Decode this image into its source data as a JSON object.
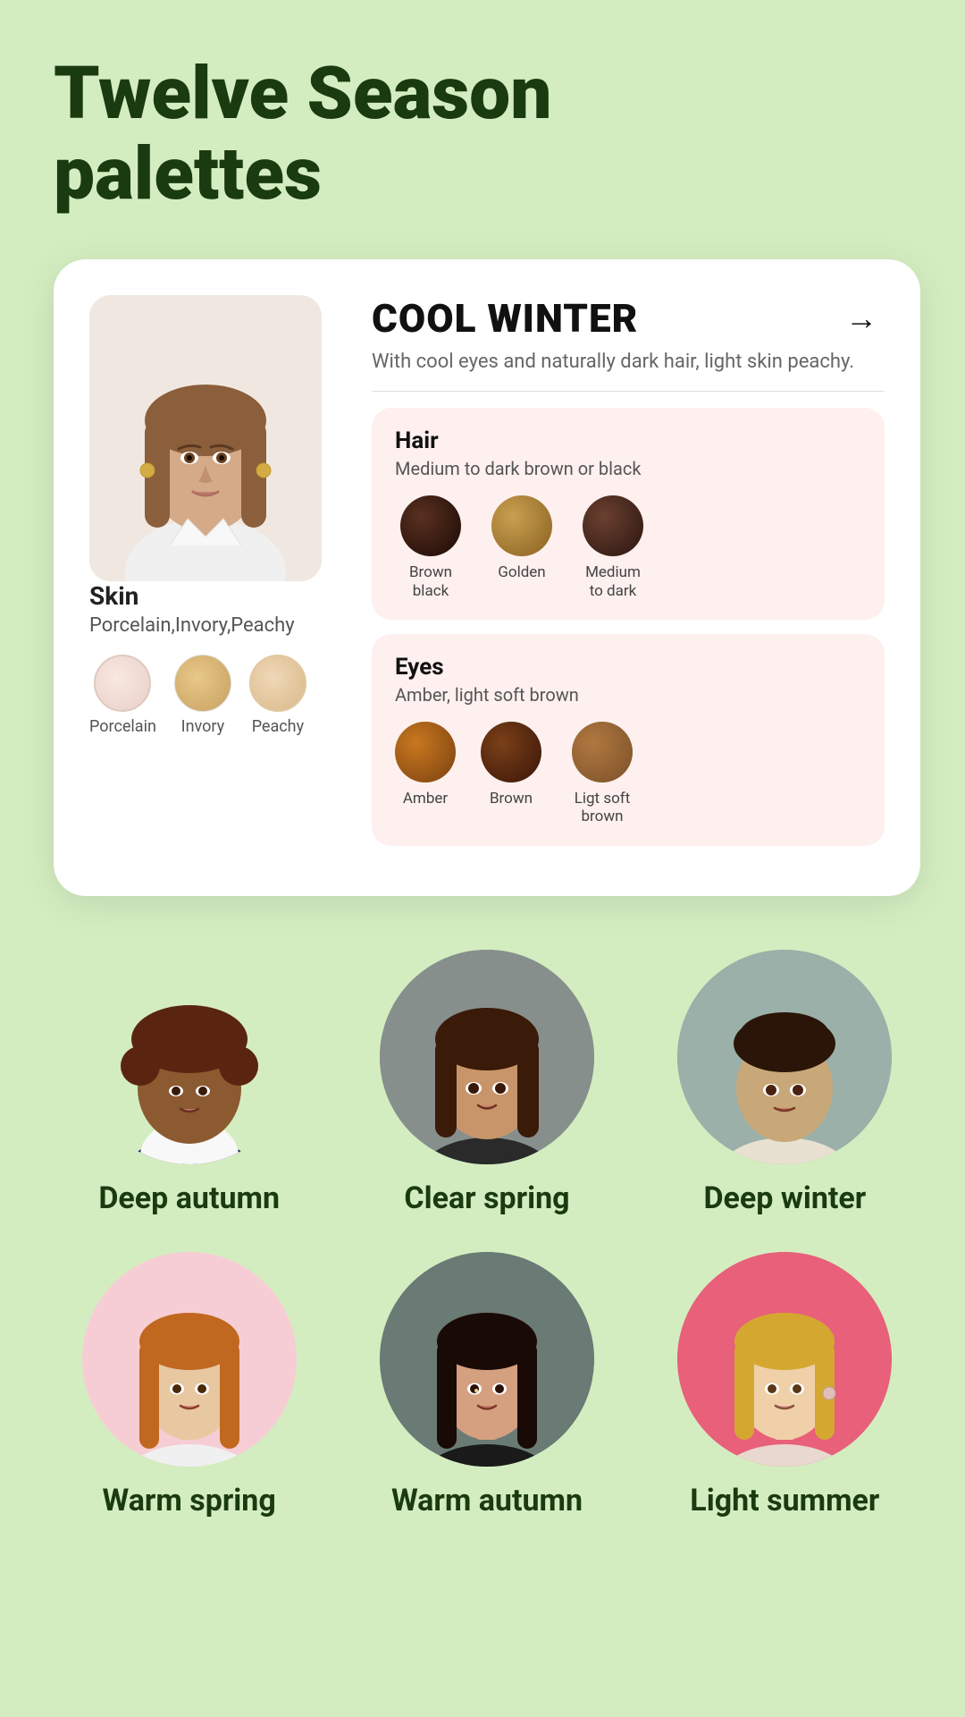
{
  "page": {
    "title_line1": "Twelve Season",
    "title_line2": "palettes"
  },
  "card": {
    "season_name": "COOL WINTER",
    "season_desc": "With cool eyes and naturally dark hair, light skin peachy.",
    "arrow": "→",
    "skin": {
      "label": "Skin",
      "sublabel": "Porcelain,Invory,Peachy",
      "swatches": [
        {
          "label": "Porcelain",
          "class": "skin-porcelain"
        },
        {
          "label": "Invory",
          "class": "skin-ivory"
        },
        {
          "label": "Peachy",
          "class": "skin-peachy"
        }
      ]
    },
    "hair": {
      "title": "Hair",
      "subtitle": "Medium to dark brown or black",
      "swatches": [
        {
          "label": "Brown black",
          "class": "hair-brown-black"
        },
        {
          "label": "Golden",
          "class": "hair-golden"
        },
        {
          "label": "Medium to dark",
          "class": "hair-medium-dark"
        }
      ]
    },
    "eyes": {
      "title": "Eyes",
      "subtitle": "Amber, light soft brown",
      "swatches": [
        {
          "label": "Amber",
          "class": "eye-amber"
        },
        {
          "label": "Brown",
          "class": "eye-brown"
        },
        {
          "label": "Ligt soft brown",
          "class": "eye-light-soft-brown"
        }
      ]
    }
  },
  "season_grid": [
    {
      "name": "Deep autumn",
      "bg": "#d4edc0",
      "row": 1
    },
    {
      "name": "Clear spring",
      "bg": "#7a8a84",
      "row": 1
    },
    {
      "name": "Deep winter",
      "bg": "#9ab0a8",
      "row": 1
    },
    {
      "name": "Warm spring",
      "bg": "#f7cdd5",
      "row": 2
    },
    {
      "name": "Warm autumn",
      "bg": "#6a7a74",
      "row": 2
    },
    {
      "name": "Light summer",
      "bg": "#e87090",
      "row": 2
    }
  ]
}
